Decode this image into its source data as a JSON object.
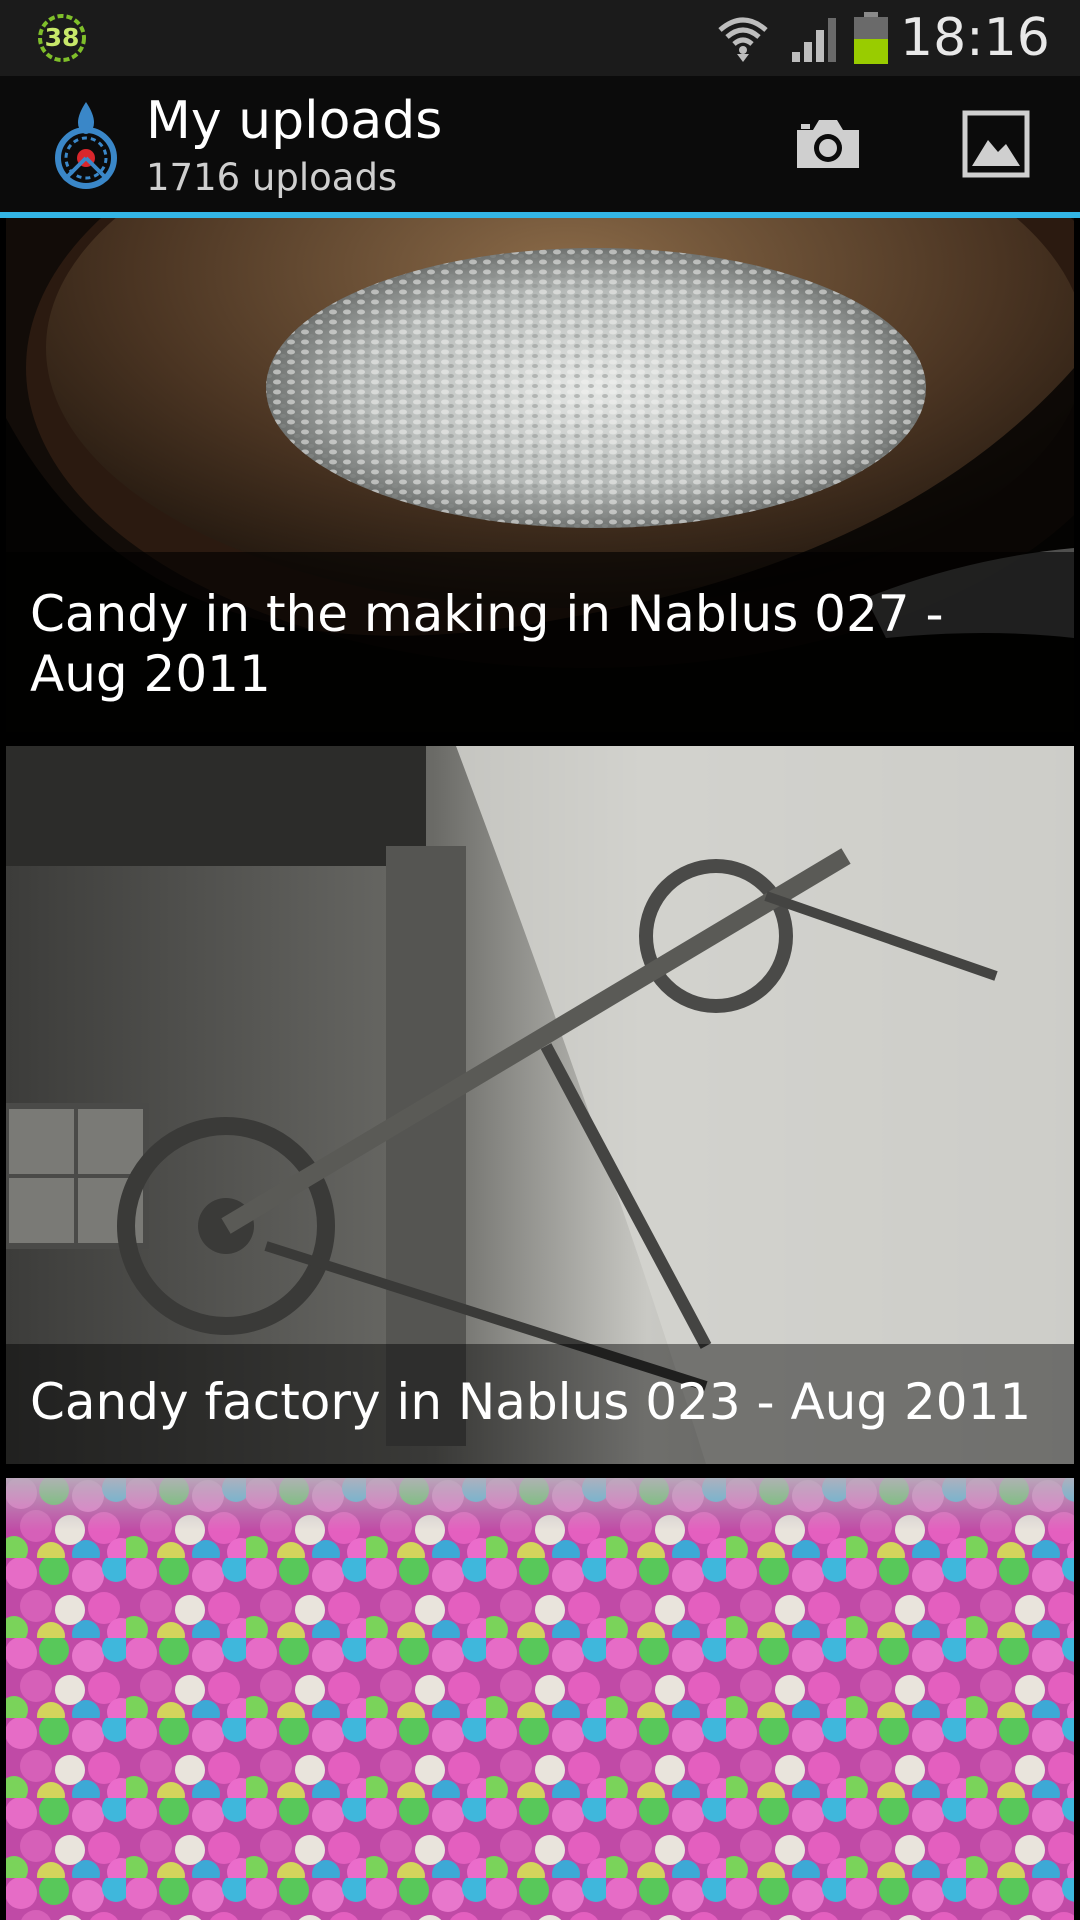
{
  "status_bar": {
    "notification_count": "38",
    "time": "18:16",
    "icons": [
      "notification-badge-icon",
      "wifi-icon",
      "signal-icon",
      "battery-icon"
    ]
  },
  "action_bar": {
    "title": "My uploads",
    "subtitle": "1716 uploads",
    "logo": "wikimedia-commons-logo-icon",
    "buttons": [
      {
        "icon": "camera-icon"
      },
      {
        "icon": "gallery-icon"
      }
    ],
    "accent_color": "#33b5e5"
  },
  "uploads": [
    {
      "caption": "Candy in the making in Nablus 027 - Aug 2011",
      "thumbnail": "bowl-of-white-candy-photo"
    },
    {
      "caption": "Candy factory in Nablus 023 - Aug 2011",
      "thumbnail": "candy-factory-machine-photo"
    },
    {
      "caption": "",
      "thumbnail": "colorful-candy-balls-photo"
    }
  ]
}
